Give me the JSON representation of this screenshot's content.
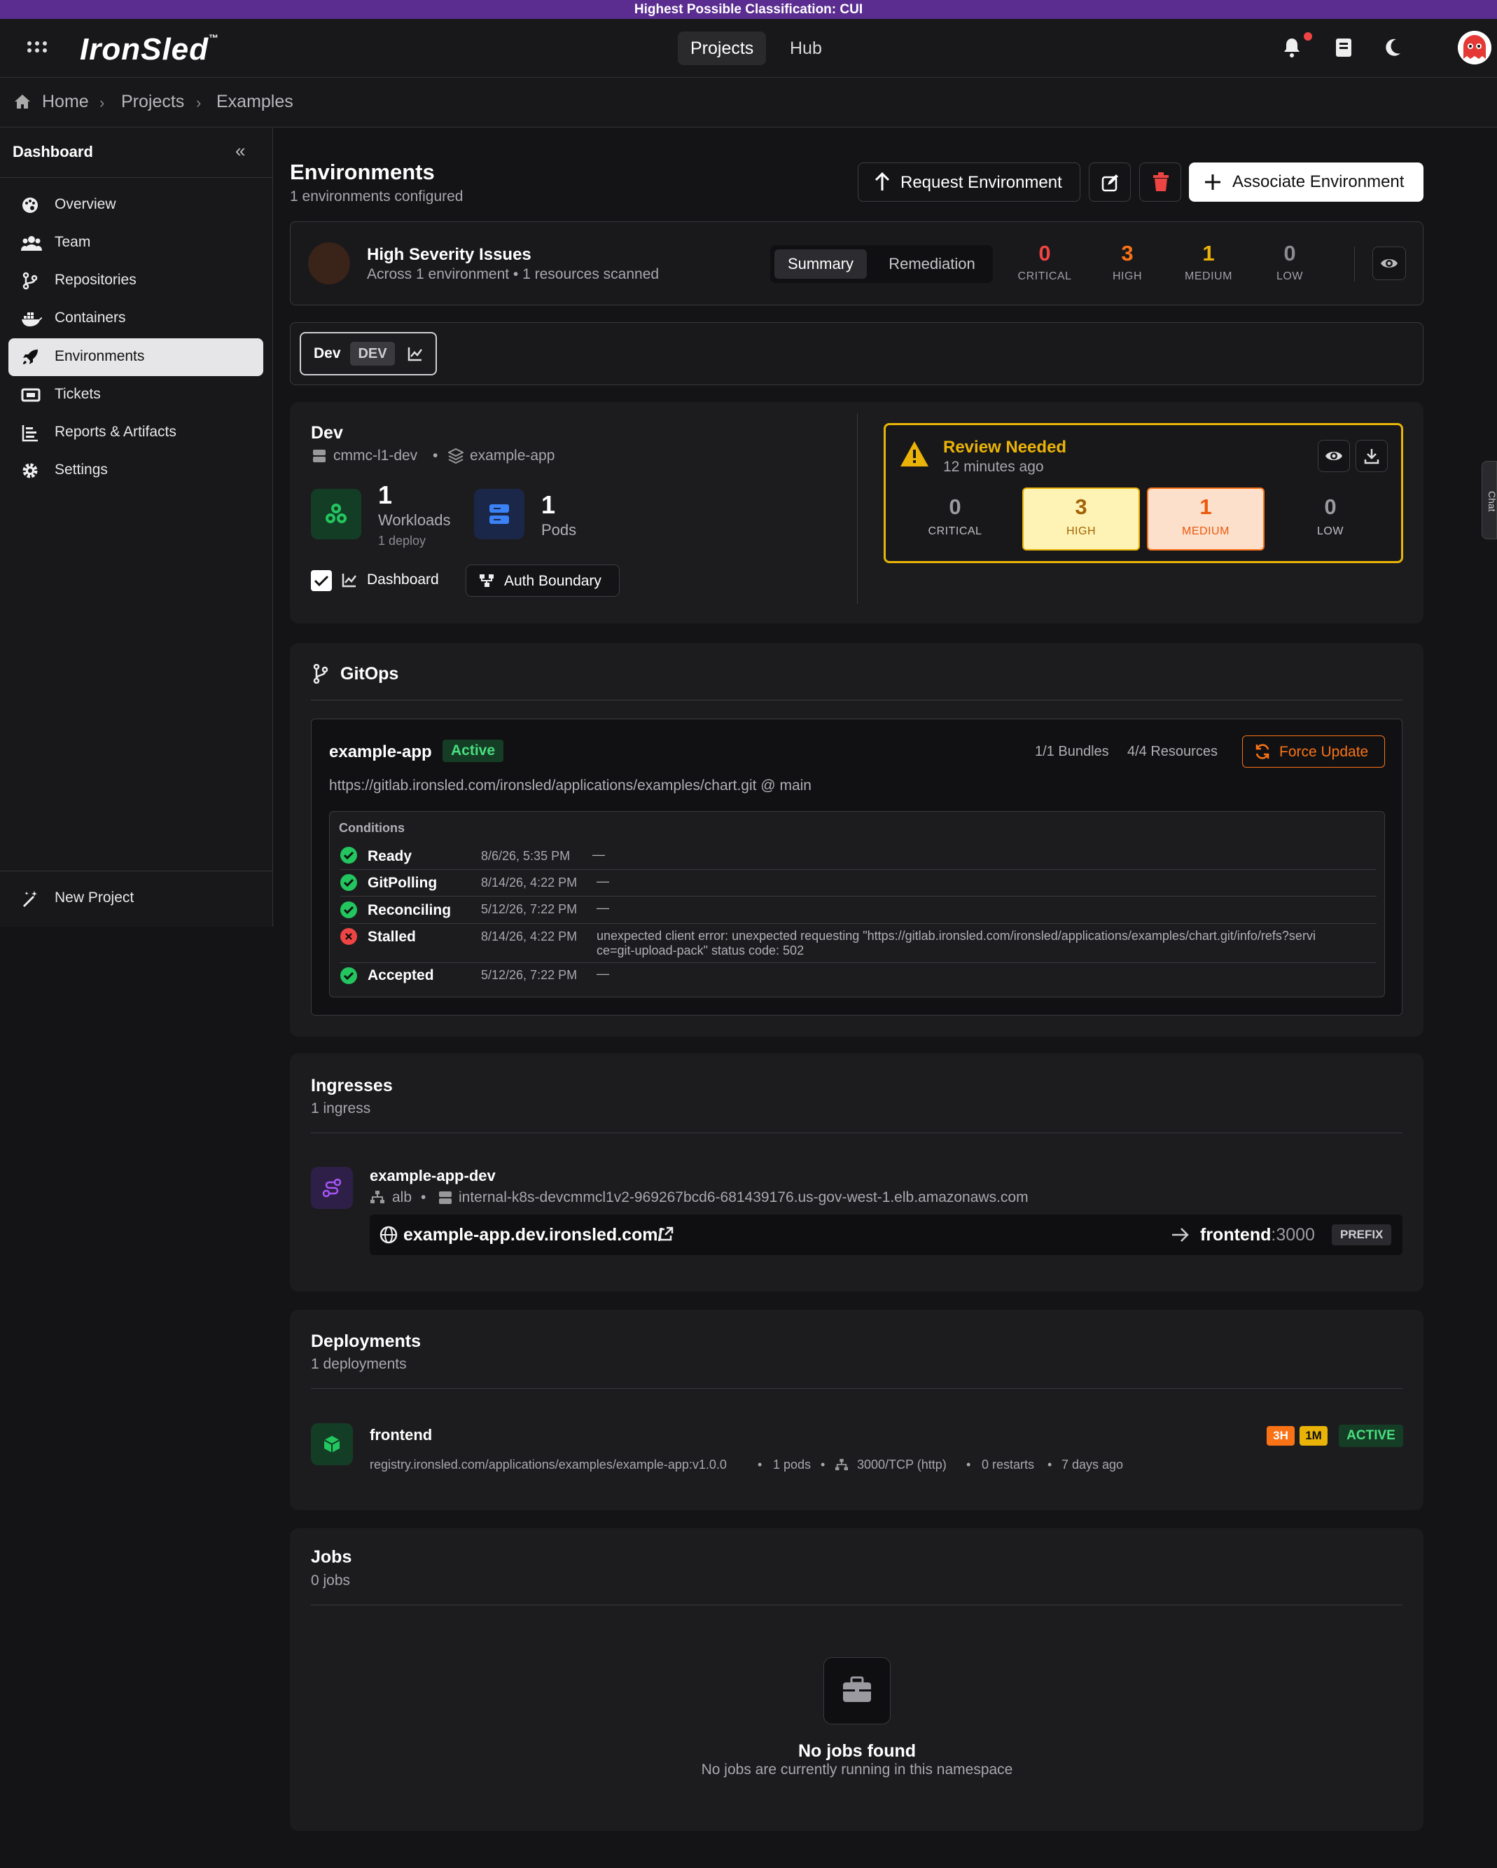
{
  "banner": "Highest Possible Classification: CUI",
  "app": {
    "logo": "IronSled",
    "tm": "™"
  },
  "nav": {
    "projects": "Projects",
    "hub": "Hub"
  },
  "breadcrumb": {
    "home": "Home",
    "projects": "Projects",
    "examples": "Examples"
  },
  "sidebar": {
    "title": "Dashboard",
    "items": [
      {
        "label": "Overview",
        "icon": "palette-icon"
      },
      {
        "label": "Team",
        "icon": "team-icon"
      },
      {
        "label": "Repositories",
        "icon": "branch-icon"
      },
      {
        "label": "Containers",
        "icon": "docker-icon"
      },
      {
        "label": "Environments",
        "icon": "rocket-icon"
      },
      {
        "label": "Tickets",
        "icon": "ticket-icon"
      },
      {
        "label": "Reports & Artifacts",
        "icon": "reports-icon"
      },
      {
        "label": "Settings",
        "icon": "gear-icon"
      }
    ],
    "new_project": "New Project"
  },
  "environments": {
    "title": "Environments",
    "subtitle": "1 environments configured",
    "request_btn": "Request Environment",
    "associate_btn": "Associate Environment"
  },
  "issues": {
    "title": "High Severity Issues",
    "subtitle": "Across 1 environment • 1 resources scanned",
    "tab_summary": "Summary",
    "tab_remediation": "Remediation",
    "critical": "0",
    "critical_lbl": "CRITICAL",
    "high": "3",
    "high_lbl": "HIGH",
    "medium": "1",
    "medium_lbl": "MEDIUM",
    "low": "0",
    "low_lbl": "LOW"
  },
  "env_tab": {
    "name": "Dev",
    "tag": "DEV"
  },
  "env_detail": {
    "title": "Dev",
    "cluster": "cmmc-l1-dev",
    "app": "example-app",
    "workloads_num": "1",
    "workloads_lbl": "Workloads",
    "workloads_sub": "1 deploy",
    "pods_num": "1",
    "pods_lbl": "Pods",
    "dashboard": "Dashboard",
    "auth_boundary": "Auth Boundary"
  },
  "review": {
    "title": "Review Needed",
    "time": "12 minutes ago",
    "critical": "0",
    "critical_lbl": "CRITICAL",
    "high": "3",
    "high_lbl": "HIGH",
    "medium": "1",
    "medium_lbl": "MEDIUM",
    "low": "0",
    "low_lbl": "LOW"
  },
  "side_tab": "Chat",
  "gitops": {
    "title": "GitOps",
    "app": "example-app",
    "status": "Active",
    "bundles": "1/1 Bundles",
    "resources": "4/4 Resources",
    "force_update": "Force Update",
    "repo": "https://gitlab.ironsled.com/ironsled/applications/examples/chart.git @ main",
    "conditions_title": "Conditions",
    "conditions": [
      {
        "name": "Ready",
        "date": "8/6/26, 5:35 PM",
        "msg": "—",
        "ok": true
      },
      {
        "name": "GitPolling",
        "date": "8/14/26, 4:22 PM",
        "msg": "—",
        "ok": true
      },
      {
        "name": "Reconciling",
        "date": "5/12/26, 7:22 PM",
        "msg": "—",
        "ok": true
      },
      {
        "name": "Stalled",
        "date": "8/14/26, 4:22 PM",
        "msg": "unexpected client error: unexpected requesting \"https://gitlab.ironsled.com/ironsled/applications/examples/chart.git/info/refs?servi",
        "msg2": "ce=git-upload-pack\" status code: 502",
        "ok": false
      },
      {
        "name": "Accepted",
        "date": "5/12/26, 7:22 PM",
        "msg": "—",
        "ok": true
      }
    ]
  },
  "ingresses": {
    "title": "Ingresses",
    "subtitle": "1 ingress",
    "name": "example-app-dev",
    "class": "alb",
    "lb": "internal-k8s-devcmmcl1v2-969267bcd6-681439176.us-gov-west-1.elb.amazonaws.com",
    "host": "example-app.dev.ironsled.com/",
    "target_svc": "frontend",
    "target_port": ":3000",
    "path_type": "PREFIX"
  },
  "deployments": {
    "title": "Deployments",
    "subtitle": "1 deployments",
    "name": "frontend",
    "badge_h": "3H",
    "badge_m": "1M",
    "status": "ACTIVE",
    "image": "registry.ironsled.com/applications/examples/example-app:v1.0.0",
    "pods": "1 pods",
    "port": "3000/TCP (http)",
    "restarts": "0 restarts",
    "age": "7 days ago"
  },
  "jobs": {
    "title": "Jobs",
    "subtitle": "0 jobs",
    "empty_title": "No jobs found",
    "empty_sub": "No jobs are currently running in this namespace"
  },
  "colors": {
    "accent_purple": "#5b2d91",
    "warn": "#eab308",
    "orange": "#f97316",
    "red": "#ef4444",
    "green": "#22c55e"
  }
}
